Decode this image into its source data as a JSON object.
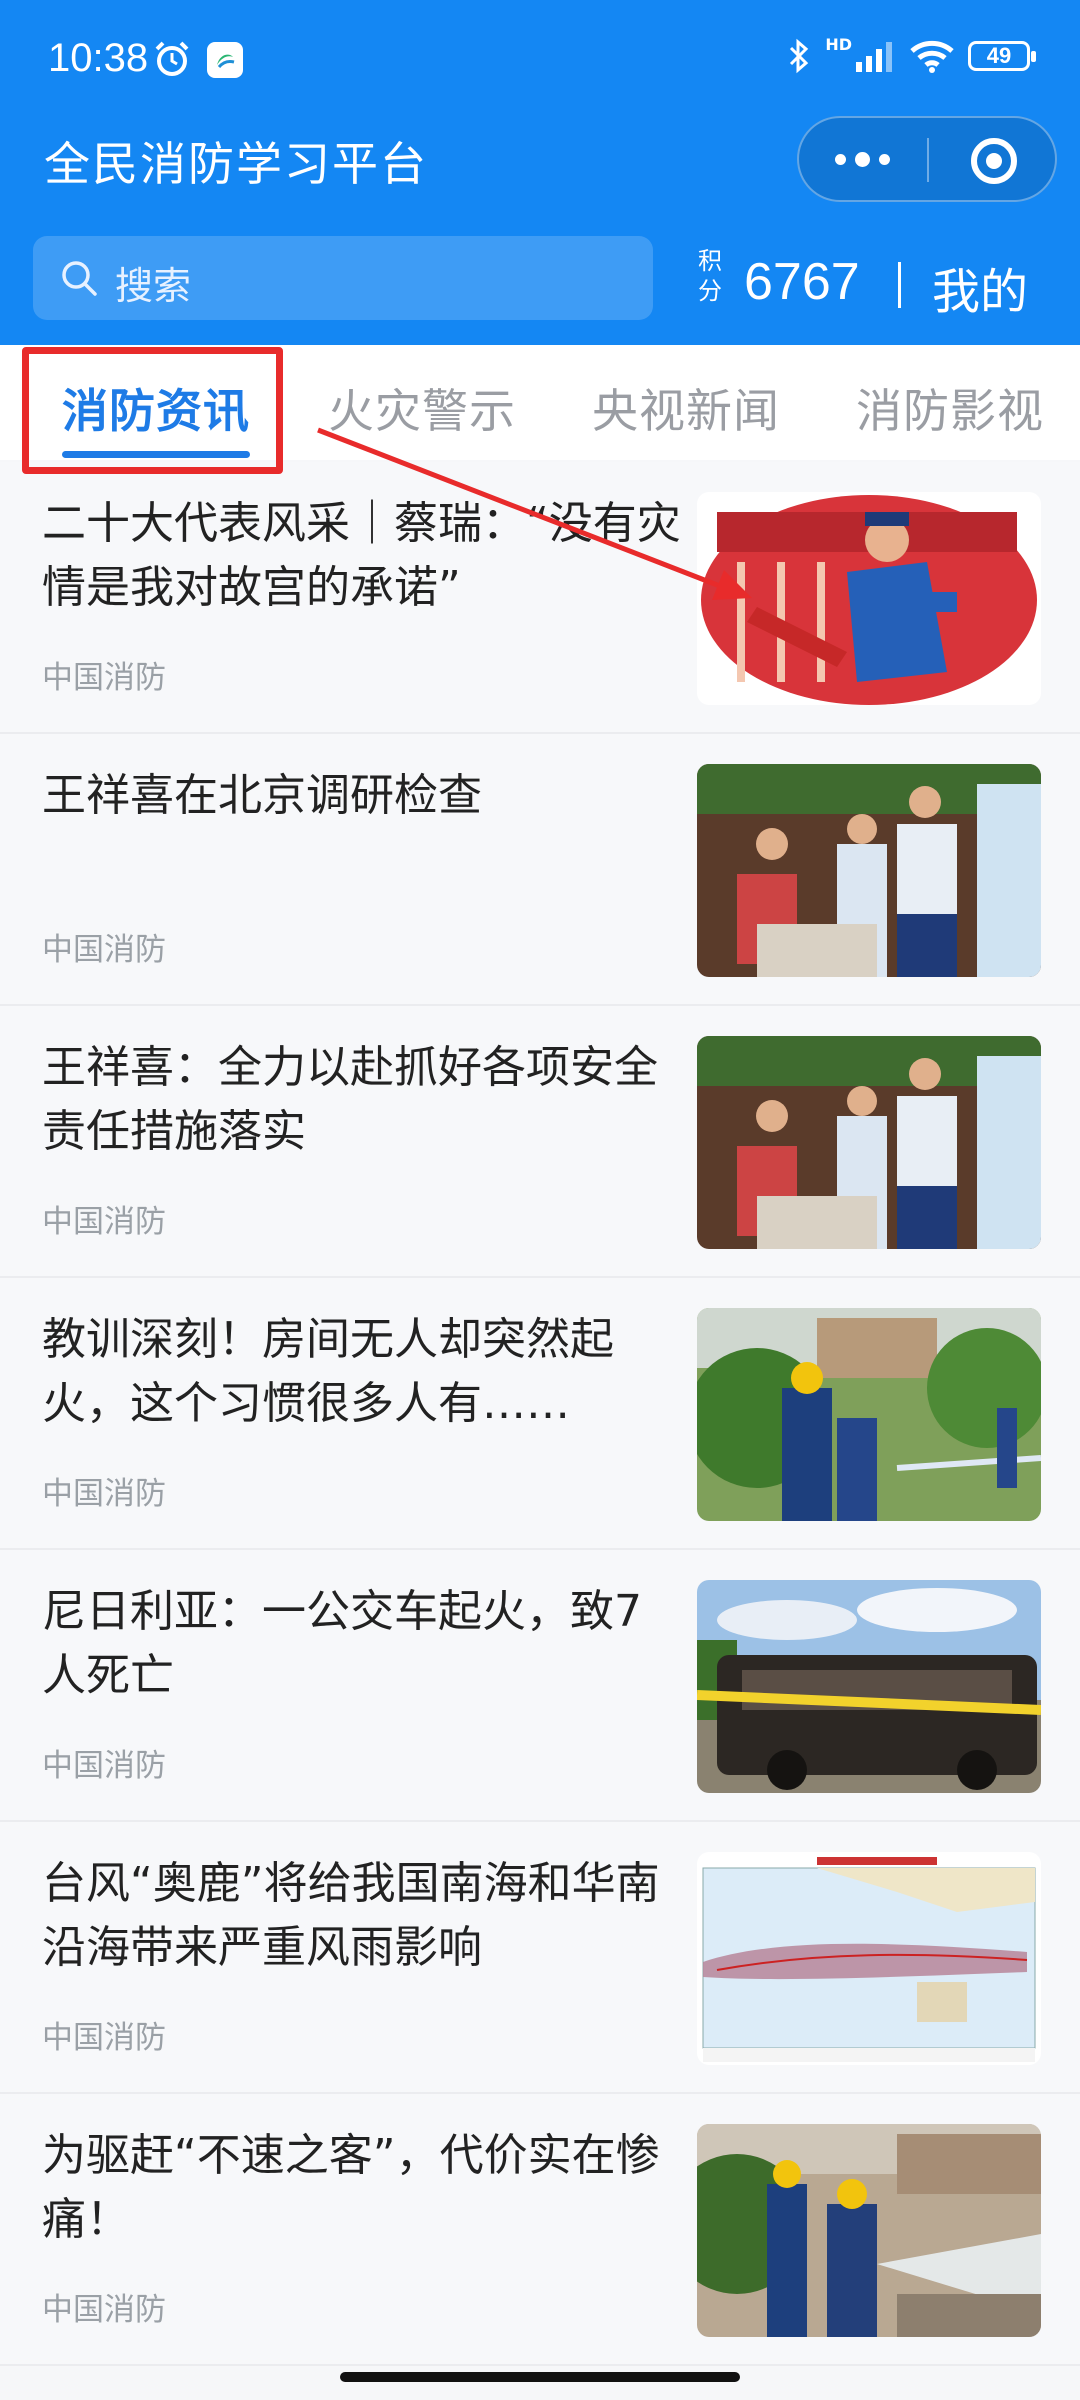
{
  "status_bar": {
    "time": "10:38",
    "network": "HD",
    "battery": "49"
  },
  "header": {
    "title": "全民消防学习平台"
  },
  "search": {
    "placeholder": "搜索"
  },
  "points": {
    "label": "积分",
    "value": "6767",
    "mine_label": "我的"
  },
  "tabs": [
    {
      "label": "消防资讯",
      "active": true
    },
    {
      "label": "火灾警示",
      "active": false
    },
    {
      "label": "央视新闻",
      "active": false
    },
    {
      "label": "消防影视",
      "active": false
    }
  ],
  "news": [
    {
      "title": "二十大代表风采｜蔡瑞：“没有灾情是我对故宫的承诺”",
      "source": "中国消防",
      "image": "firefighter-with-extinguisher-photo"
    },
    {
      "title": "王祥喜在北京调研检查",
      "source": "中国消防",
      "image": "inspection-in-shop-photo"
    },
    {
      "title": "王祥喜：全力以赴抓好各项安全责任措施落实",
      "source": "中国消防",
      "image": "inspection-in-shop-photo"
    },
    {
      "title": "教训深刻！房间无人却突然起火，这个习惯很多人有……",
      "source": "中国消防",
      "image": "firefighters-spraying-water-photo"
    },
    {
      "title": "尼日利亚：一公交车起火，致7人死亡",
      "source": "中国消防",
      "image": "burned-bus-photo"
    },
    {
      "title": "台风“奥鹿”将给我国南海和华南沿海带来严重风雨影响",
      "source": "中国消防",
      "image": "typhoon-track-map"
    },
    {
      "title": "为驱赶“不速之客”，代价实在惨痛！",
      "source": "中国消防",
      "image": "firefighters-hose-photo"
    }
  ],
  "colors": {
    "header_blue": "#1487f3",
    "active_tab": "#1e7be6",
    "annotation_red": "#e82b2b"
  }
}
